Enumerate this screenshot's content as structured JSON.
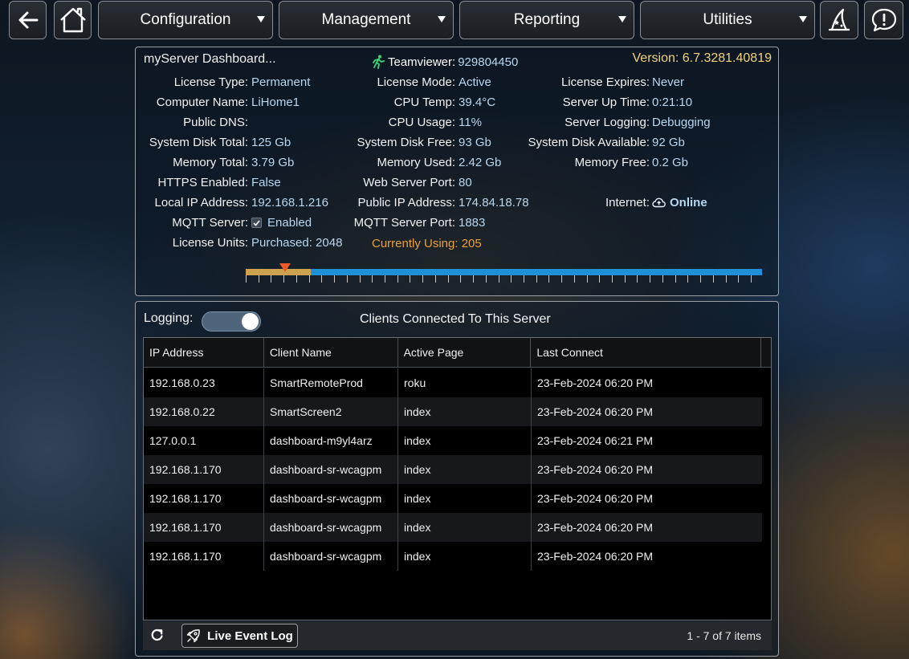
{
  "nav": {
    "menus": [
      {
        "label": "Configuration"
      },
      {
        "label": "Management"
      },
      {
        "label": "Reporting"
      },
      {
        "label": "Utilities"
      }
    ]
  },
  "info": {
    "title": "myServer Dashboard...",
    "teamviewer_label": "Teamviewer:",
    "teamviewer_value": "929804450",
    "version": "Version: 6.7.3281.40819",
    "col1": [
      {
        "label": "License Type:",
        "value": "Permanent"
      },
      {
        "label": "Computer Name:",
        "value": "LiHome1"
      },
      {
        "label": "Public DNS:",
        "value": ""
      },
      {
        "label": "System Disk Total:",
        "value": "125 Gb"
      },
      {
        "label": "Memory Total:",
        "value": "3.79 Gb"
      },
      {
        "label": "HTTPS Enabled:",
        "value": "False"
      },
      {
        "label": "Local IP Address:",
        "value": "192.168.1.216"
      },
      {
        "label": "MQTT Server:",
        "value": "Enabled"
      },
      {
        "label": "License Units:",
        "value": "Purchased: 2048"
      }
    ],
    "col2": [
      {
        "label": "License Mode:",
        "value": "Active"
      },
      {
        "label": "CPU Temp:",
        "value": "39.4°C"
      },
      {
        "label": "CPU Usage:",
        "value": "11%"
      },
      {
        "label": "System Disk Free:",
        "value": "93 Gb"
      },
      {
        "label": "Memory Used:",
        "value": "2.42 Gb"
      },
      {
        "label": "Web Server Port:",
        "value": "80"
      },
      {
        "label": "Public IP Address:",
        "value": "174.84.18.78"
      },
      {
        "label": "MQTT Server Port:",
        "value": "1883"
      }
    ],
    "currently_using": "Currently Using: 205",
    "col3": [
      {
        "label": "License Expires:",
        "value": "Never"
      },
      {
        "label": "Server Up Time:",
        "value": "0:21:10"
      },
      {
        "label": "Server Logging:",
        "value": "Debugging"
      },
      {
        "label": "System Disk Available:",
        "value": "92 Gb"
      },
      {
        "label": "Memory Free:",
        "value": "0.2 Gb"
      }
    ],
    "internet_label": "Internet:",
    "internet_value": "Online",
    "license_bar": {
      "purchased": 2048,
      "using": 205,
      "used_color": "#cda24f",
      "free_color": "#1f8fd6",
      "marker_color": "#f0592a"
    }
  },
  "clients": {
    "logging_label": "Logging:",
    "logging_on": true,
    "title": "Clients Connected To This Server",
    "columns": [
      "IP Address",
      "Client Name",
      "Active Page",
      "Last Connect"
    ],
    "rows": [
      [
        "192.168.0.23",
        "SmartRemoteProd",
        "roku",
        "23-Feb-2024 06:20 PM"
      ],
      [
        "192.168.0.22",
        "SmartScreen2",
        "index",
        "23-Feb-2024 06:20 PM"
      ],
      [
        "127.0.0.1",
        "dashboard-m9yl4arz",
        "index",
        "23-Feb-2024 06:21 PM"
      ],
      [
        "192.168.1.170",
        "dashboard-sr-wcagpm",
        "index",
        "23-Feb-2024 06:20 PM"
      ],
      [
        "192.168.1.170",
        "dashboard-sr-wcagpm",
        "index",
        "23-Feb-2024 06:20 PM"
      ],
      [
        "192.168.1.170",
        "dashboard-sr-wcagpm",
        "index",
        "23-Feb-2024 06:20 PM"
      ],
      [
        "192.168.1.170",
        "dashboard-sr-wcagpm",
        "index",
        "23-Feb-2024 06:20 PM"
      ]
    ],
    "live_event_log": "Live Event Log",
    "pager": "1 - 7 of 7 items"
  }
}
